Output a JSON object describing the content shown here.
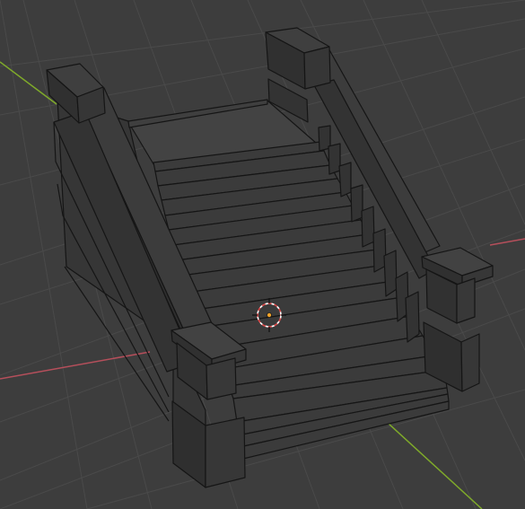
{
  "viewport": {
    "view": "3D Viewport",
    "shading": "solid",
    "overlay": "wireframe",
    "object": "stair-model"
  },
  "colors": {
    "background": "#3d3d3d",
    "grid": "#4a4a4a",
    "x_axis": "#b54f5b",
    "y_axis": "#7faa2a",
    "mesh_fill": "#3a3a3a",
    "mesh_edge": "#151515",
    "cursor_ring": "#e04a4a",
    "cursor_ring_alt": "#ffffff",
    "origin_dot": "#f2a32a"
  },
  "icons": {
    "cursor": "3d-cursor-icon",
    "origin": "object-origin-icon"
  }
}
